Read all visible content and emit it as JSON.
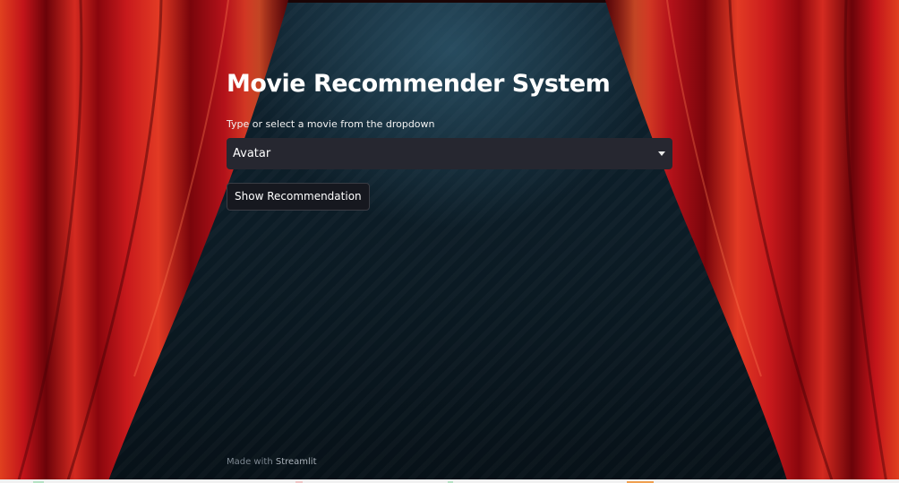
{
  "app": {
    "title": "Movie Recommender System"
  },
  "selector": {
    "label": "Type or select a movie from the dropdown",
    "selected_value": "Avatar",
    "icon": "caret-down-icon"
  },
  "actions": {
    "show_button_label": "Show Recommendation"
  },
  "footer": {
    "prefix": "Made with ",
    "brand": "Streamlit"
  },
  "theme": {
    "curtain_red": "#c4121a",
    "curtain_dark": "#5a0208",
    "background": "#0f2330",
    "select_bg": "#262730"
  }
}
